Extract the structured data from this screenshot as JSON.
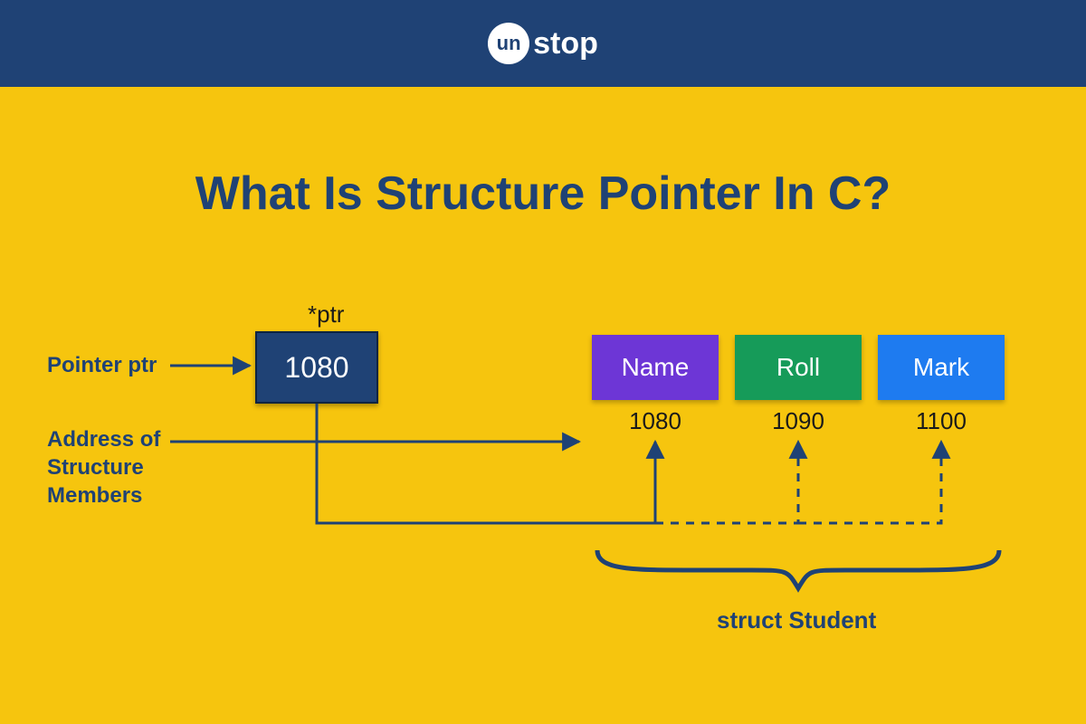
{
  "brand": {
    "circle_text": "un",
    "suffix": "stop"
  },
  "title": "What Is Structure Pointer In C?",
  "pointer": {
    "label_above": "*ptr",
    "value": "1080"
  },
  "labels": {
    "pointer_ptr": "Pointer ptr",
    "address_of": "Address of\nStructure\nMembers",
    "struct_name": "struct Student"
  },
  "members": [
    {
      "name": "Name",
      "address": "1080",
      "color": "#6d36d6"
    },
    {
      "name": "Roll",
      "address": "1090",
      "color": "#169b59"
    },
    {
      "name": "Mark",
      "address": "1100",
      "color": "#1e7bf0"
    }
  ]
}
